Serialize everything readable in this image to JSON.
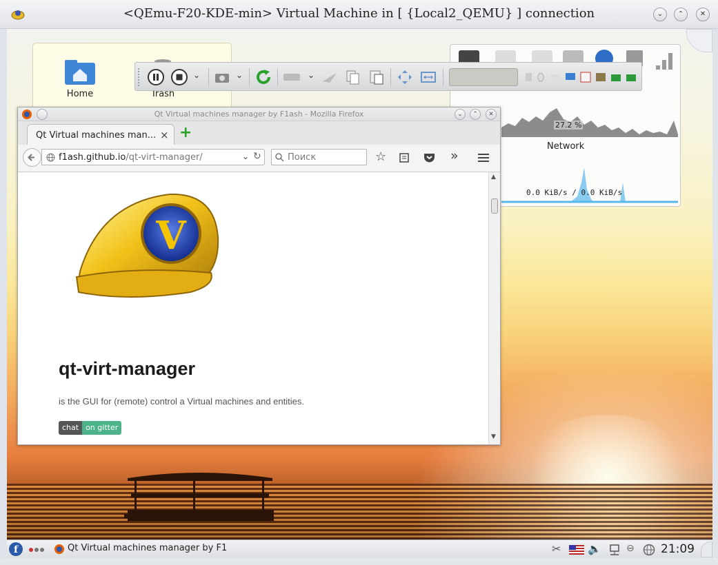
{
  "window": {
    "title": "<QEmu-F20-KDE-min> Virtual Machine in [ {Local2_QEMU} ] connection",
    "minimize": "⌄",
    "maximize": "⌃",
    "close": "✕"
  },
  "desktop": {
    "icons": [
      {
        "label": "Home",
        "icon": "home-folder-icon"
      },
      {
        "label": "Trash",
        "icon": "trash-icon"
      }
    ]
  },
  "system_monitor": {
    "cpu_value": "27.2 %",
    "network_label": "Network",
    "network_rate": "0.0 KiB/s / 0.0 KiB/s"
  },
  "firefox": {
    "title": "Qt Virtual machines manager by F1ash - Mozilla Firefox",
    "tab_label": "Qt Virtual machines man...",
    "tab_close": "×",
    "new_tab": "+",
    "url_host": "f1ash.github.io",
    "url_path": "/qt-virt-manager/",
    "search_placeholder": "Поиск",
    "overflow": "»"
  },
  "page": {
    "title": "qt-virt-manager",
    "description": "is the GUI for (remote) control a Virtual machines and entities.",
    "badge_left": "chat",
    "badge_right": "on gitter",
    "logo_letter": "V"
  },
  "taskbar": {
    "task_label": "Qt Virtual machines manager by F1",
    "clock": "21:09"
  },
  "colors": {
    "firefox_orange": "#e66000",
    "reload_green": "#2aa12a",
    "badge_green": "#4db38a",
    "kde_blue": "#2b5ba8"
  }
}
